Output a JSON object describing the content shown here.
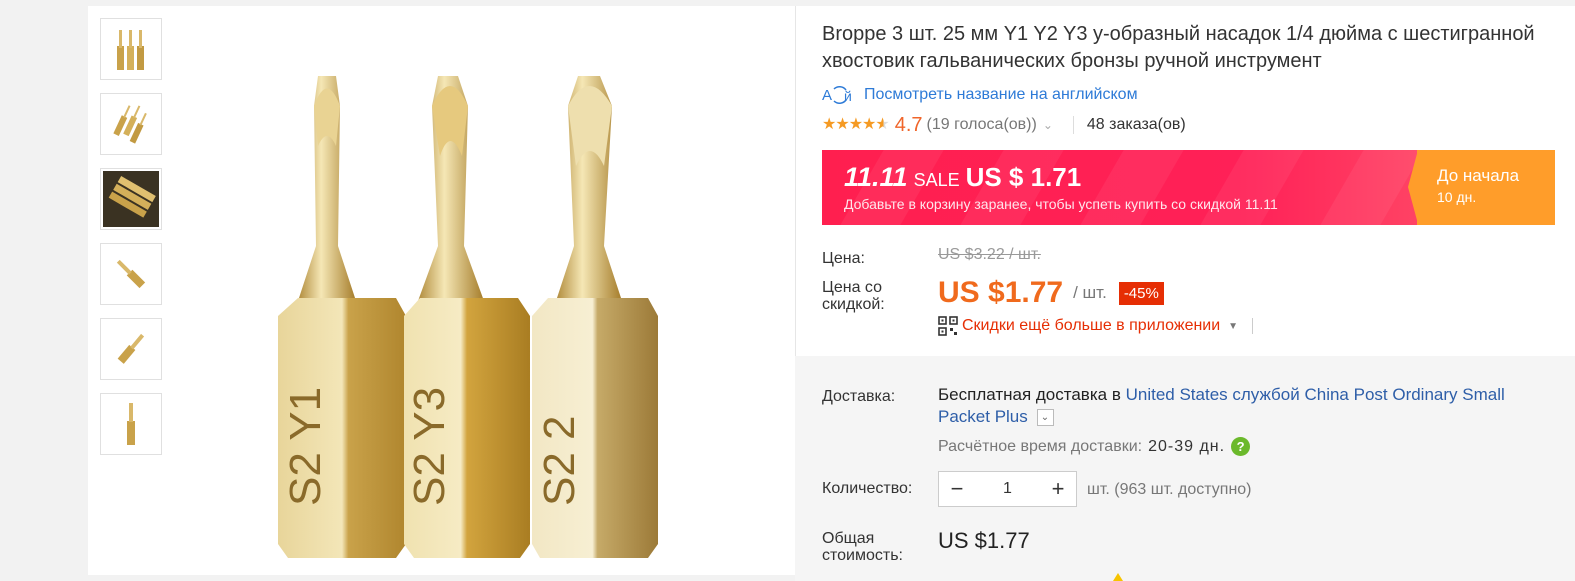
{
  "gallery": {
    "thumbnails": [
      "thumb-1",
      "thumb-2",
      "thumb-3",
      "thumb-4",
      "thumb-5",
      "thumb-6"
    ],
    "main_image_bits": [
      {
        "label": "S2 Y1"
      },
      {
        "label": "S2 Y3"
      },
      {
        "label": "S2 2"
      }
    ]
  },
  "product": {
    "title": "Broppe 3 шт. 25 мм Y1 Y2 Y3 у-образный насадок 1/4 дюйма с шестигранной хвостовик гальванических бронзы ручной инструмент",
    "translate_link": "Посмотреть название на английском",
    "rating": "4.7",
    "votes": "(19 голоса(ов))",
    "orders": "48 заказа(ов)"
  },
  "banner": {
    "event": "11.11",
    "sale_word": "SALE",
    "sale_price": "US $ 1.71",
    "subtitle": "Добавьте в корзину заранее, чтобы успеть купить со скидкой 11.11",
    "countdown_label": "До начала",
    "countdown_value": "10 дн."
  },
  "pricing": {
    "price_label": "Цена:",
    "old_price": "US $3.22 / шт.",
    "discount_label_1": "Цена со",
    "discount_label_2": "скидкой:",
    "new_price": "US $1.77",
    "unit": "/ шт.",
    "discount_badge": "-45%",
    "app_discount": "Скидки ещё больше в приложении"
  },
  "delivery": {
    "label": "Доставка:",
    "free_text": "Бесплатная доставка в",
    "country_service": "United States службой China Post Ordinary Small Packet Plus",
    "eta_label": "Расчётное время доставки:",
    "eta_value": "20-39 дн."
  },
  "quantity": {
    "label": "Количество:",
    "value": "1",
    "available": "шт. (963 шт. доступно)"
  },
  "total": {
    "label_1": "Общая",
    "label_2": "стоимость:",
    "value": "US $1.77"
  },
  "colors": {
    "accent_orange": "#f06a1d",
    "sale_red": "#ff2057",
    "countdown_orange": "#ff9d2a",
    "link_blue": "#2e7bd7"
  }
}
